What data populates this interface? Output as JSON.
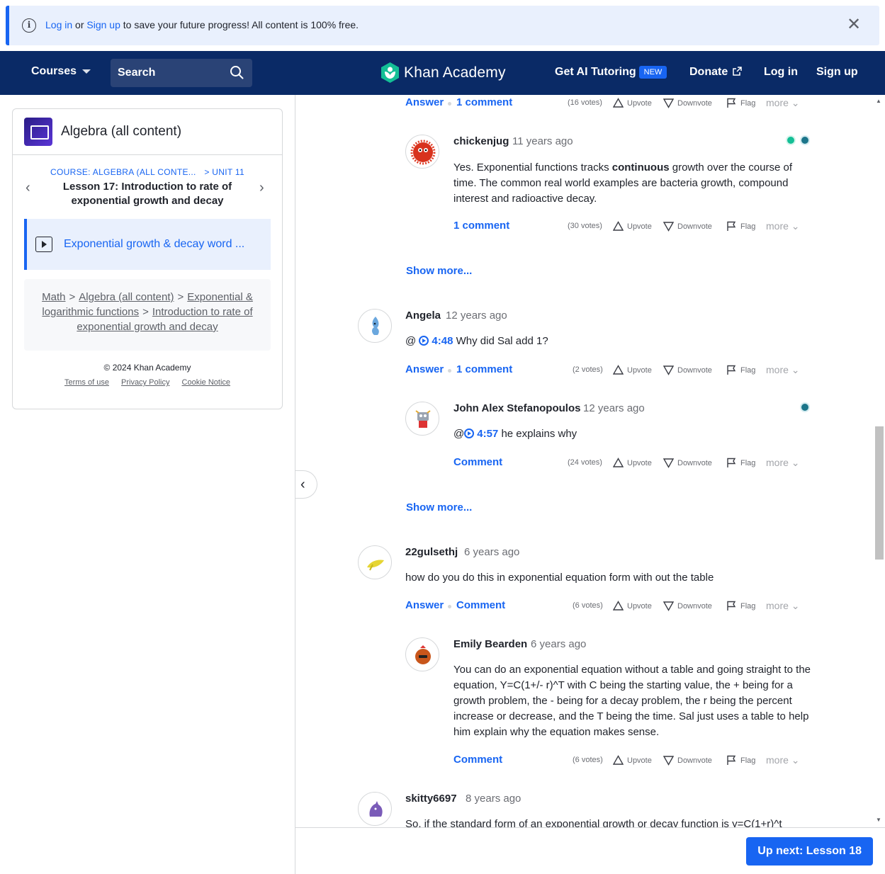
{
  "banner": {
    "login": "Log in",
    "or": "or",
    "signup": "Sign up",
    "message": "to save your future progress! All content is 100% free."
  },
  "nav": {
    "courses": "Courses",
    "search": "Search",
    "brand": "Khan Academy",
    "ai_tutoring": "Get AI Tutoring",
    "new_badge": "NEW",
    "donate": "Donate",
    "login": "Log in",
    "signup": "Sign up"
  },
  "sidebar": {
    "course_title": "Algebra (all content)",
    "course_crumb": "COURSE: ALGEBRA (ALL CONTE...",
    "unit_crumb": "> UNIT 11",
    "lesson_title": "Lesson 17: Introduction to rate of exponential growth and decay",
    "active_item": "Exponential growth & decay word ...",
    "breadcrumb": {
      "math": "Math",
      "algebra": "Algebra (all content)",
      "exp": "Exponential & logarithmic functions",
      "intro": "Introduction to rate of exponential growth and decay",
      "sep": ">"
    },
    "copyright": "© 2024 Khan Academy",
    "terms": "Terms of use",
    "privacy": "Privacy Policy",
    "cookie": "Cookie Notice"
  },
  "labels": {
    "answer": "Answer",
    "comment": "Comment",
    "one_comment": "1 comment",
    "upvote": "Upvote",
    "downvote": "Downvote",
    "flag": "Flag",
    "more": "more",
    "show_more": "Show more..."
  },
  "comments": {
    "top_votes": "(16 votes)",
    "c1": {
      "user": "chickenjug",
      "time": "11 years ago",
      "body_pre": "Yes. Exponential functions tracks ",
      "body_bold": "continuous",
      "body_post": " growth over the course of time. The common real world examples are bacteria growth, compound interest and radioactive decay.",
      "votes": "(30 votes)"
    },
    "q2": {
      "user": "Angela",
      "time": "12 years ago",
      "at": "@",
      "timestamp": "4:48",
      "body": "Why did Sal add 1?",
      "votes": "(2 votes)"
    },
    "a2": {
      "user": "John Alex Stefanopoulos",
      "time": "12 years ago",
      "at": "@",
      "timestamp": "4:57",
      "body": "he explains why",
      "votes": "(24 votes)"
    },
    "q3": {
      "user": "22gulsethj",
      "time": "6 years ago",
      "body": "how do you do this in exponential equation form with out the table",
      "votes": "(6 votes)"
    },
    "a3": {
      "user": "Emily Bearden",
      "time": "6 years ago",
      "body": "You can do an exponential equation without a table and going straight to the equation, Y=C(1+/- r)^T with C being the starting value, the + being for a growth problem, the - being for a decay problem, the r being the percent increase or decrease, and the T being the time. Sal just uses a table to help him explain why the equation makes sense.",
      "votes": "(6 votes)"
    },
    "q4": {
      "user": "skitty6697",
      "time": "8 years ago",
      "body": "So, if the standard form of an exponential growth or decay function is y=C(1+r)^t"
    }
  },
  "bottom": {
    "up_next": "Up next: Lesson 18"
  },
  "colors": {
    "brand_navy": "#0a2a66",
    "link_blue": "#1865f2",
    "ka_green": "#14bf96"
  }
}
